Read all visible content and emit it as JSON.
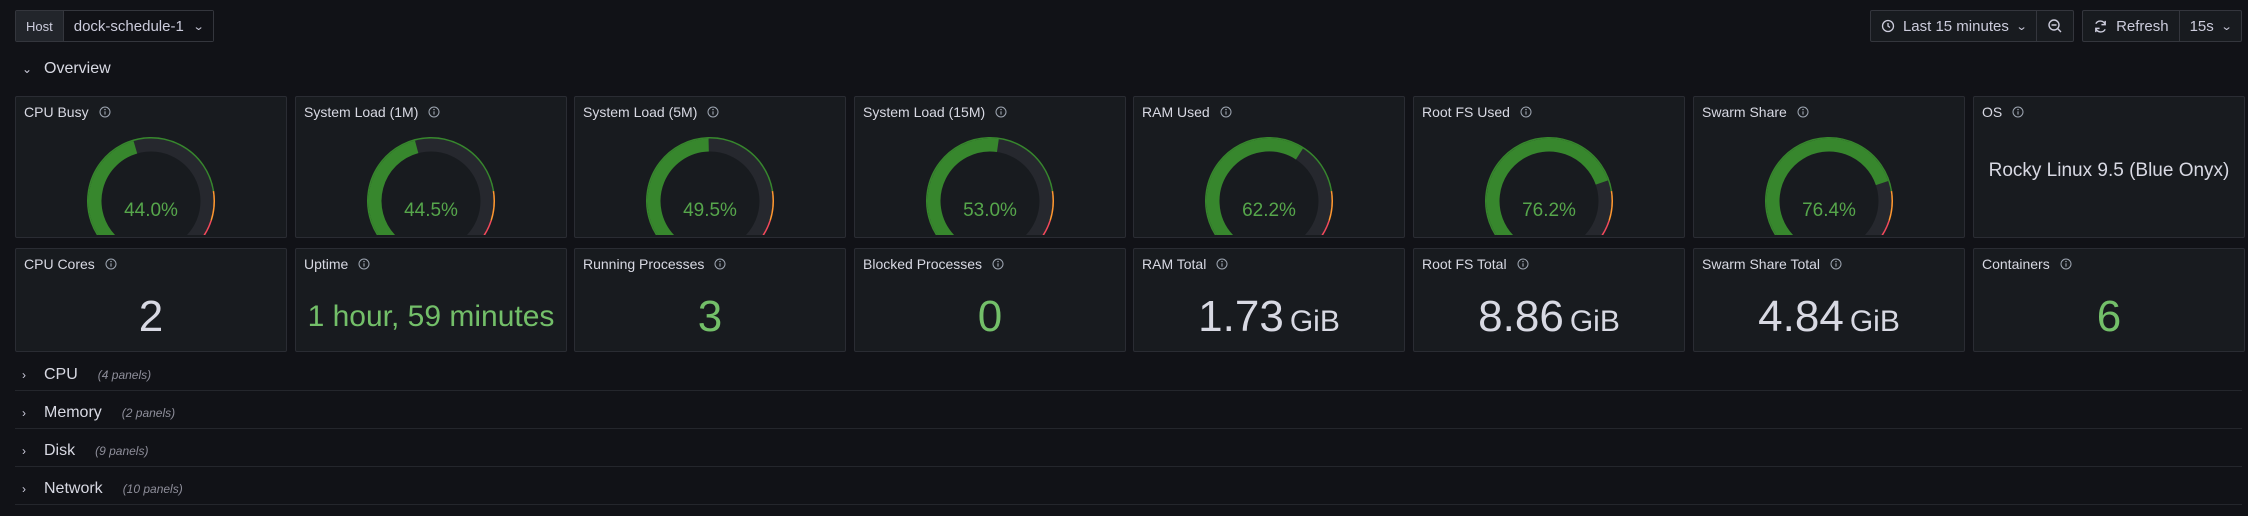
{
  "topbar": {
    "host_label": "Host",
    "host_value": "dock-schedule-1",
    "time_range": "Last 15 minutes",
    "refresh_label": "Refresh",
    "refresh_interval": "15s"
  },
  "rows": {
    "overview": {
      "title": "Overview"
    },
    "cpu": {
      "title": "CPU",
      "count": "(4 panels)"
    },
    "memory": {
      "title": "Memory",
      "count": "(2 panels)"
    },
    "disk": {
      "title": "Disk",
      "count": "(9 panels)"
    },
    "network": {
      "title": "Network",
      "count": "(10 panels)"
    }
  },
  "gauges": [
    {
      "title": "CPU Busy",
      "value": "44.0%",
      "percent": 44.0
    },
    {
      "title": "System Load (1M)",
      "value": "44.5%",
      "percent": 44.5
    },
    {
      "title": "System Load (5M)",
      "value": "49.5%",
      "percent": 49.5
    },
    {
      "title": "System Load (15M)",
      "value": "53.0%",
      "percent": 53.0
    },
    {
      "title": "RAM Used",
      "value": "62.2%",
      "percent": 62.2
    },
    {
      "title": "Root FS Used",
      "value": "76.2%",
      "percent": 76.2
    },
    {
      "title": "Swarm Share",
      "value": "76.4%",
      "percent": 76.4
    }
  ],
  "os_panel": {
    "title": "OS",
    "value": "Rocky Linux 9.5 (Blue Onyx)"
  },
  "stats": [
    {
      "title": "CPU Cores",
      "value": "2",
      "unit": "",
      "color": "#d8d9e3"
    },
    {
      "title": "Uptime",
      "value": "1 hour, 59 minutes",
      "unit": "",
      "color": "#73bf69"
    },
    {
      "title": "Running Processes",
      "value": "3",
      "unit": "",
      "color": "#73bf69"
    },
    {
      "title": "Blocked Processes",
      "value": "0",
      "unit": "",
      "color": "#73bf69"
    },
    {
      "title": "RAM Total",
      "value": "1.73",
      "unit": "GiB",
      "color": "#d8d9e3"
    },
    {
      "title": "Root FS Total",
      "value": "8.86",
      "unit": "GiB",
      "color": "#d8d9e3"
    },
    {
      "title": "Swarm Share Total",
      "value": "4.84",
      "unit": "GiB",
      "color": "#d8d9e3"
    },
    {
      "title": "Containers",
      "value": "6",
      "unit": "",
      "color": "#73bf69"
    }
  ],
  "colors": {
    "green": "#37872d",
    "value_green": "#56a64b",
    "text": "#d8d9e3",
    "threshold_orange": "#ff9830",
    "threshold_red": "#f2495c"
  }
}
